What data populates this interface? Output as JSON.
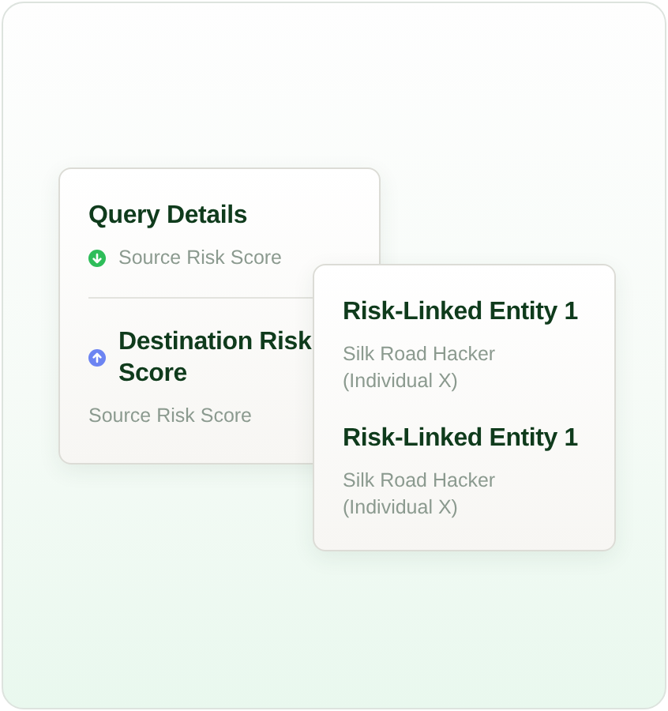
{
  "query_card": {
    "title": "Query Details",
    "sections": [
      {
        "kind": "label",
        "rising": false,
        "color": "#2ebd59",
        "text": "Source Risk Score"
      },
      {
        "kind": "heading",
        "rising": true,
        "color": "#6c84f2",
        "text": "Destination Risk Score",
        "subtitle": "Source Risk Score"
      }
    ]
  },
  "entity_card": {
    "entities": [
      {
        "name": "Risk-Linked Entity 1",
        "description": "Silk Road Hacker (Individual X)"
      },
      {
        "name": "Risk-Linked Entity 1",
        "description": "Silk Road Hacker (Individual X)"
      }
    ]
  }
}
